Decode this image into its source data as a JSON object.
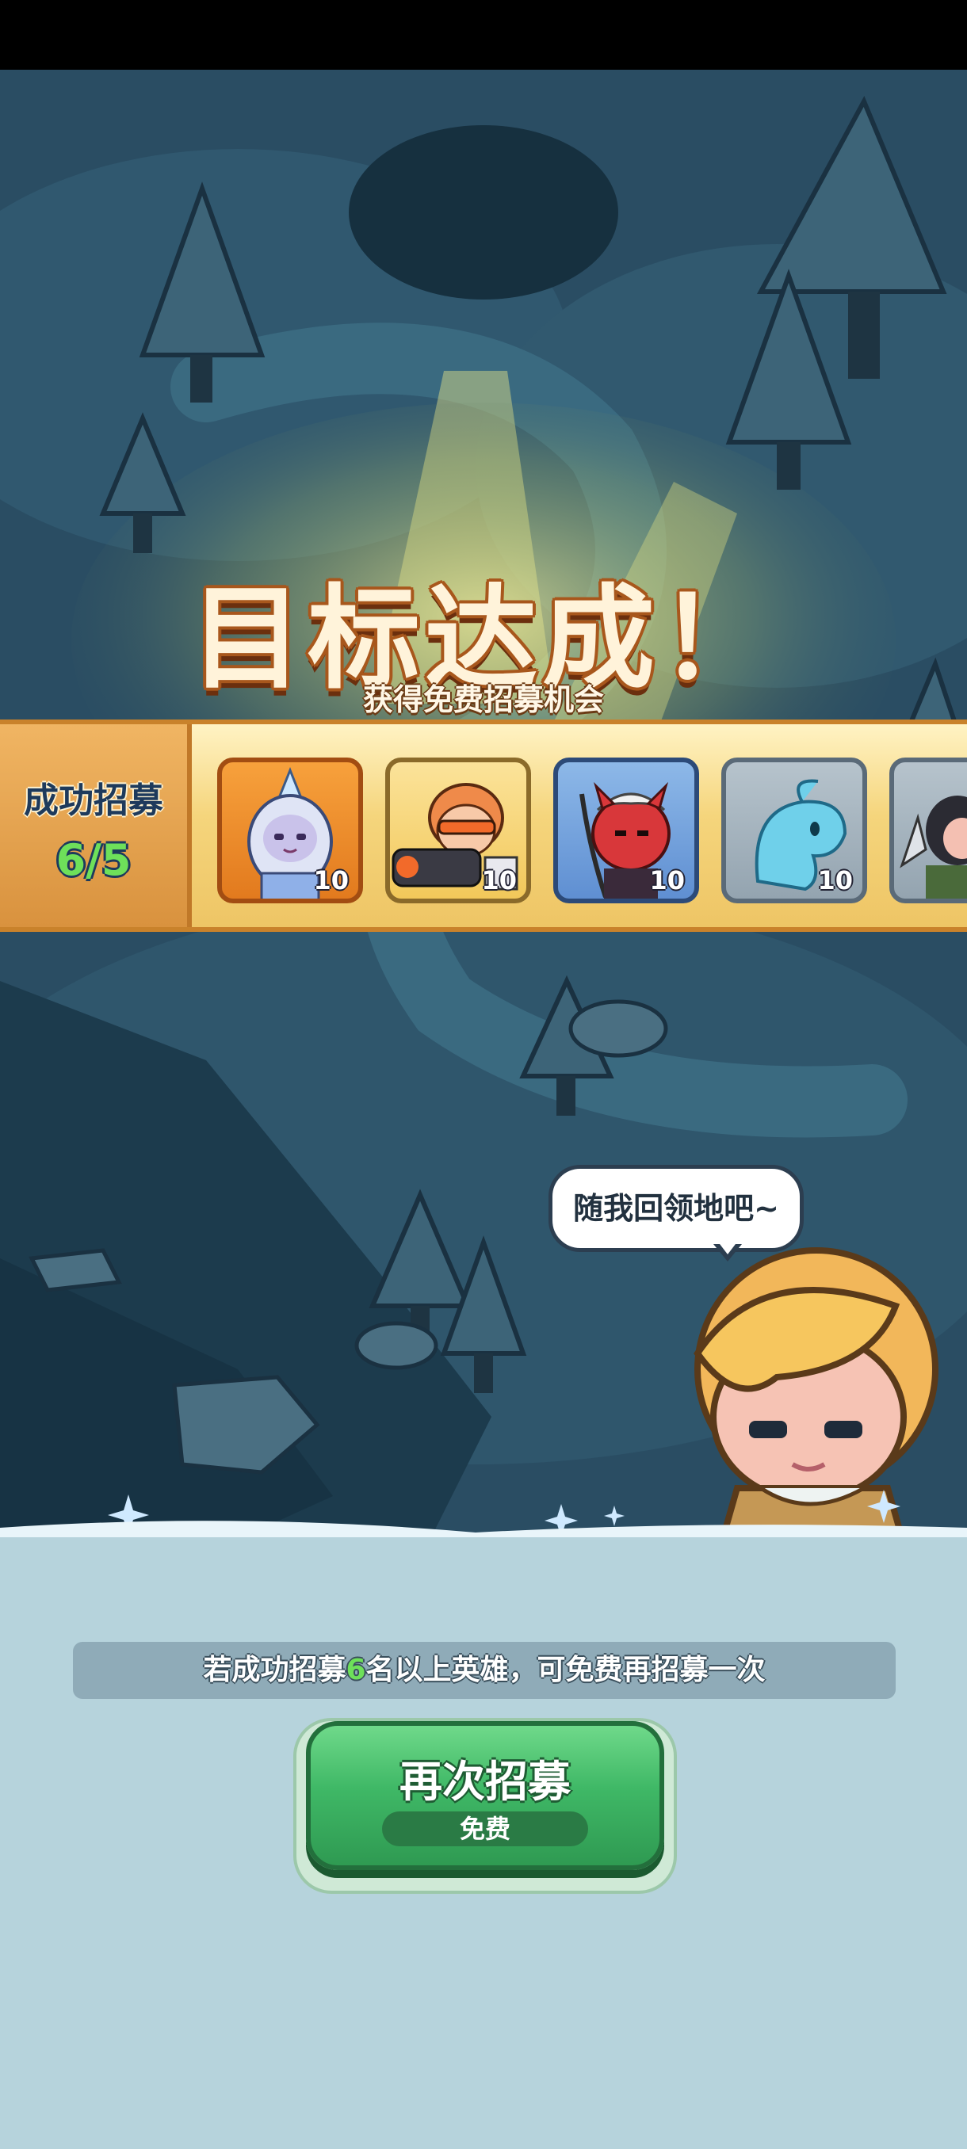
{
  "title": "目标达成！",
  "subtitle": "获得免费招募机会",
  "recruit": {
    "label": "成功招募",
    "count": "6/5",
    "heroes": [
      {
        "name": "ice-queen",
        "level": "10",
        "frame": "orange"
      },
      {
        "name": "gunner",
        "level": "10",
        "frame": "gold"
      },
      {
        "name": "red-samurai",
        "level": "10",
        "frame": "blue"
      },
      {
        "name": "blue-slime-creature",
        "level": "10",
        "frame": "gray"
      },
      {
        "name": "dagger-rogue",
        "level": "",
        "frame": "gray"
      }
    ]
  },
  "npc": {
    "speech": "随我回领地吧~"
  },
  "bottom": {
    "info_prefix": "若成功招募",
    "info_highlight": "6",
    "info_suffix": "名以上英雄，可免费再招募一次",
    "button_label": "再次招募",
    "button_cost": "免费"
  },
  "colors": {
    "accent_green": "#6ee05a",
    "title_orange": "#a8571c",
    "banner_gold": "#f5d57c"
  }
}
